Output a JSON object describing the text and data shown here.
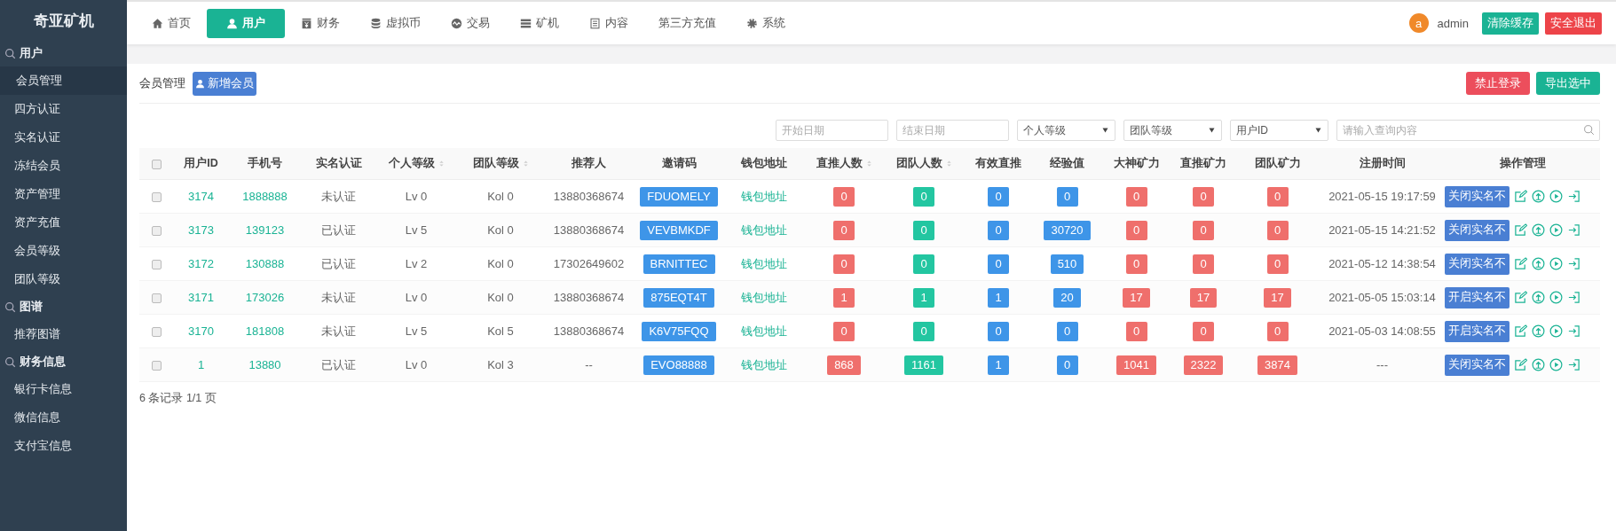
{
  "sidebar": {
    "title": "奇亚矿机",
    "groups": [
      {
        "title": "用户",
        "items": [
          {
            "label": "会员管理",
            "selected": true
          },
          {
            "label": "四方认证",
            "selected": false
          },
          {
            "label": "实名认证",
            "selected": false
          },
          {
            "label": "冻结会员",
            "selected": false
          },
          {
            "label": "资产管理",
            "selected": false
          },
          {
            "label": "资产充值",
            "selected": false
          },
          {
            "label": "会员等级",
            "selected": false
          },
          {
            "label": "团队等级",
            "selected": false
          }
        ]
      },
      {
        "title": "图谱",
        "items": [
          {
            "label": "推荐图谱",
            "selected": false
          }
        ]
      },
      {
        "title": "财务信息",
        "items": [
          {
            "label": "银行卡信息",
            "selected": false
          },
          {
            "label": "微信信息",
            "selected": false
          },
          {
            "label": "支付宝信息",
            "selected": false
          }
        ]
      }
    ]
  },
  "top_nav": {
    "items": [
      {
        "label": "首页",
        "selected": false
      },
      {
        "label": "用户",
        "selected": true
      },
      {
        "label": "财务",
        "selected": false
      },
      {
        "label": "虚拟币",
        "selected": false
      },
      {
        "label": "交易",
        "selected": false
      },
      {
        "label": "矿机",
        "selected": false
      },
      {
        "label": "内容",
        "selected": false
      },
      {
        "label": "第三方充值",
        "selected": false
      },
      {
        "label": "系统",
        "selected": false
      }
    ],
    "user": {
      "avatar_letter": "a",
      "name": "admin"
    },
    "buttons": [
      {
        "label": "清除缓存",
        "kind": "success"
      },
      {
        "label": "安全退出",
        "kind": "danger"
      }
    ]
  },
  "page": {
    "title": "会员管理",
    "add_button": "新增会员",
    "buttons": [
      {
        "label": "禁止登录",
        "kind": "danger"
      },
      {
        "label": "导出选中",
        "kind": "success"
      }
    ]
  },
  "filters": [
    {
      "kind": "date",
      "placeholder": "开始日期"
    },
    {
      "kind": "date",
      "placeholder": "结束日期"
    },
    {
      "kind": "select",
      "value": "个人等级"
    },
    {
      "kind": "select",
      "value": "团队等级"
    },
    {
      "kind": "select",
      "value": "用户ID"
    },
    {
      "kind": "search",
      "placeholder": "请输入查询内容"
    }
  ],
  "table": {
    "select_all": {
      "checked": false
    },
    "columns": [
      {
        "label": "用户ID",
        "kind": "link",
        "sortable": false
      },
      {
        "label": "手机号",
        "kind": "link",
        "sortable": false
      },
      {
        "label": "实名认证",
        "kind": "text",
        "sortable": false
      },
      {
        "label": "个人等级",
        "kind": "text",
        "sortable": true
      },
      {
        "label": "团队等级",
        "kind": "text",
        "sortable": true
      },
      {
        "label": "推荐人",
        "kind": "text",
        "sortable": false
      },
      {
        "label": "邀请码",
        "kind": "code",
        "sortable": false
      },
      {
        "label": "钱包地址",
        "kind": "link",
        "sortable": false
      },
      {
        "label": "直推人数",
        "kind": "badge",
        "color": "#ef6f6c",
        "sortable": true
      },
      {
        "label": "团队人数",
        "kind": "badge",
        "color": "#23c6a1",
        "sortable": true
      },
      {
        "label": "有效直推",
        "kind": "badge",
        "color": "#3e95e8",
        "sortable": false
      },
      {
        "label": "经验值",
        "kind": "badge",
        "color": "#3e95e8",
        "sortable": false
      },
      {
        "label": "大神矿力",
        "kind": "badge",
        "color": "#ef6f6c",
        "sortable": false
      },
      {
        "label": "直推矿力",
        "kind": "badge",
        "color": "#ef6f6c",
        "sortable": false
      },
      {
        "label": "团队矿力",
        "kind": "badge",
        "color": "#ef6f6c",
        "sortable": false
      },
      {
        "label": "注册时间",
        "kind": "text",
        "sortable": false
      },
      {
        "label": "操作管理",
        "kind": "actions",
        "sortable": false
      }
    ],
    "rows": [
      {
        "checked": false,
        "cells": [
          "3174",
          "1888888",
          "未认证",
          "Lv 0",
          "Kol 0",
          "13880368674",
          "FDUOMELY",
          "钱包地址",
          "0",
          "0",
          "0",
          "0",
          "0",
          "0",
          "0",
          "2021-05-15 19:17:59",
          "关闭实名不"
        ]
      },
      {
        "checked": false,
        "cells": [
          "3173",
          "139123",
          "已认证",
          "Lv 5",
          "Kol 0",
          "13880368674",
          "VEVBMKDF",
          "钱包地址",
          "0",
          "0",
          "0",
          "30720",
          "0",
          "0",
          "0",
          "2021-05-15 14:21:52",
          "关闭实名不"
        ]
      },
      {
        "checked": false,
        "cells": [
          "3172",
          "130888",
          "已认证",
          "Lv 2",
          "Kol 0",
          "17302649602",
          "BRNITTEC",
          "钱包地址",
          "0",
          "0",
          "0",
          "510",
          "0",
          "0",
          "0",
          "2021-05-12 14:38:54",
          "关闭实名不"
        ]
      },
      {
        "checked": false,
        "cells": [
          "3171",
          "173026",
          "未认证",
          "Lv 0",
          "Kol 0",
          "13880368674",
          "875EQT4T",
          "钱包地址",
          "1",
          "1",
          "1",
          "20",
          "17",
          "17",
          "17",
          "2021-05-05 15:03:14",
          "开启实名不"
        ]
      },
      {
        "checked": false,
        "cells": [
          "3170",
          "181808",
          "未认证",
          "Lv 5",
          "Kol 5",
          "13880368674",
          "K6V75FQQ",
          "钱包地址",
          "0",
          "0",
          "0",
          "0",
          "0",
          "0",
          "0",
          "2021-05-03 14:08:55",
          "开启实名不"
        ]
      },
      {
        "checked": false,
        "cells": [
          "1",
          "13880",
          "已认证",
          "Lv 0",
          "Kol 3",
          "--",
          "EVO88888",
          "钱包地址",
          "868",
          "1161",
          "1",
          "0",
          "1041",
          "2322",
          "3874",
          "---",
          "关闭实名不"
        ]
      }
    ]
  },
  "footer": "6 条记录 1/1 页"
}
